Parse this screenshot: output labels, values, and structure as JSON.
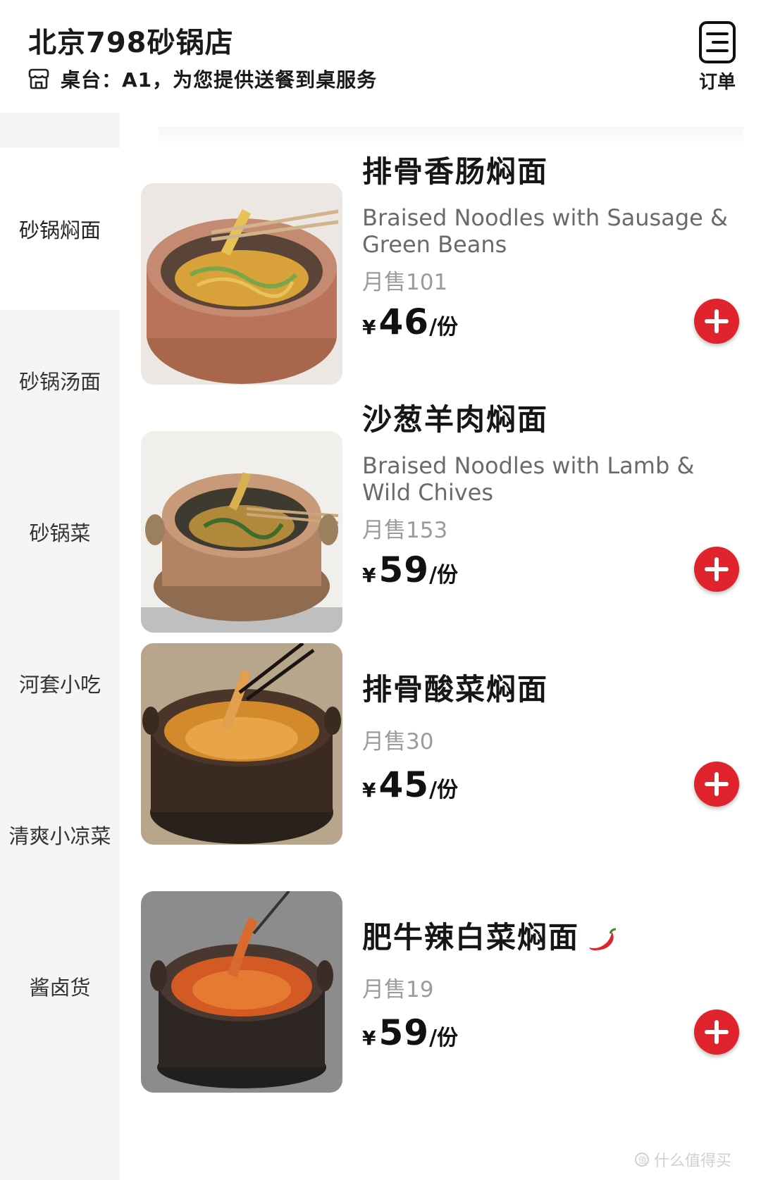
{
  "header": {
    "store_name": "北京798砂锅店",
    "table_info": "桌台：A1，为您提供送餐到桌服务",
    "order_label": "订单"
  },
  "sidebar": {
    "items": [
      {
        "label": "砂锅焖面",
        "active": true
      },
      {
        "label": "砂锅汤面",
        "active": false
      },
      {
        "label": "砂锅菜",
        "active": false
      },
      {
        "label": "河套小吃",
        "active": false
      },
      {
        "label": "清爽小凉菜",
        "active": false
      },
      {
        "label": "酱卤货",
        "active": false
      }
    ]
  },
  "menu": {
    "items": [
      {
        "name": "排骨香肠焖面",
        "english": "Braised Noodles with Sausage & Green Beans",
        "sold": "月售101",
        "currency": "¥",
        "price": "46",
        "unit": "/份"
      },
      {
        "name": "沙葱羊肉焖面",
        "english": "Braised Noodles with Lamb & Wild Chives",
        "sold": "月售153",
        "currency": "¥",
        "price": "59",
        "unit": "/份"
      },
      {
        "name": "排骨酸菜焖面",
        "english": "",
        "sold": "月售30",
        "currency": "¥",
        "price": "45",
        "unit": "/份"
      },
      {
        "name": "肥牛辣白菜焖面",
        "english": "",
        "sold": "月售19",
        "currency": "¥",
        "price": "59",
        "unit": "/份",
        "spicy_icon": "chili-pepper-icon"
      }
    ]
  },
  "watermark": "什么值得买",
  "colors": {
    "accent": "#e0242d",
    "sidebar_bg": "#f5f5f5",
    "secondary_text": "#9b9b9b"
  }
}
